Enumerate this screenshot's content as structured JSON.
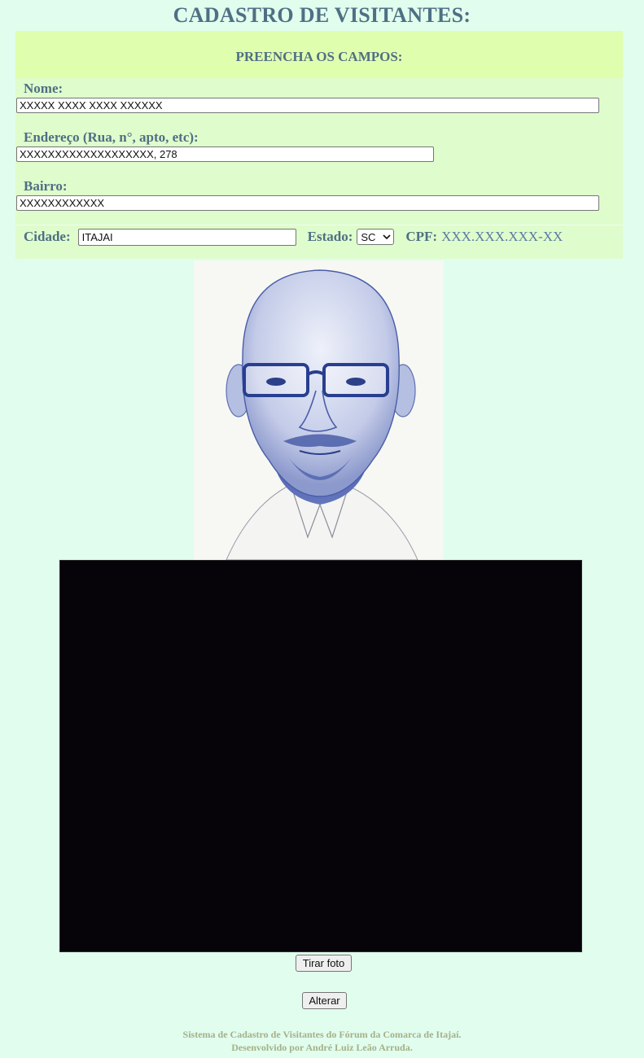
{
  "page": {
    "title": "CADASTRO DE VISITANTES:",
    "colors": {
      "background": "#e0fdee",
      "header_band": "#e0ffae",
      "form_band": "#dffccc",
      "label": "#4f6f84",
      "footer": "#a6b087"
    }
  },
  "form": {
    "header": "PREENCHA OS CAMPOS:",
    "nome": {
      "label": "Nome:",
      "value": "XXXXX XXXX XXXX XXXXXX"
    },
    "endereco": {
      "label": "Endereço (Rua, n°, apto, etc):",
      "value": "XXXXXXXXXXXXXXXXXXX, 278"
    },
    "bairro": {
      "label": "Bairro:",
      "value": "XXXXXXXXXXXX"
    },
    "cidade": {
      "label": "Cidade:",
      "value": "ITAJAI"
    },
    "estado": {
      "label": "Estado:",
      "selected": "SC"
    },
    "cpf": {
      "label": "CPF:",
      "value": "XXX.XXX.XXX-XX"
    }
  },
  "photo": {
    "icon": "portrait-drawing"
  },
  "webcam": {
    "icon": "webcam-feed"
  },
  "buttons": {
    "take_photo": "Tirar foto",
    "update": "Alterar"
  },
  "footer": {
    "line1": "Sistema de Cadastro de Visitantes do Fórum da Comarca de Itajaí.",
    "line2": "Desenvolvido por André Luiz Leão Arruda."
  }
}
